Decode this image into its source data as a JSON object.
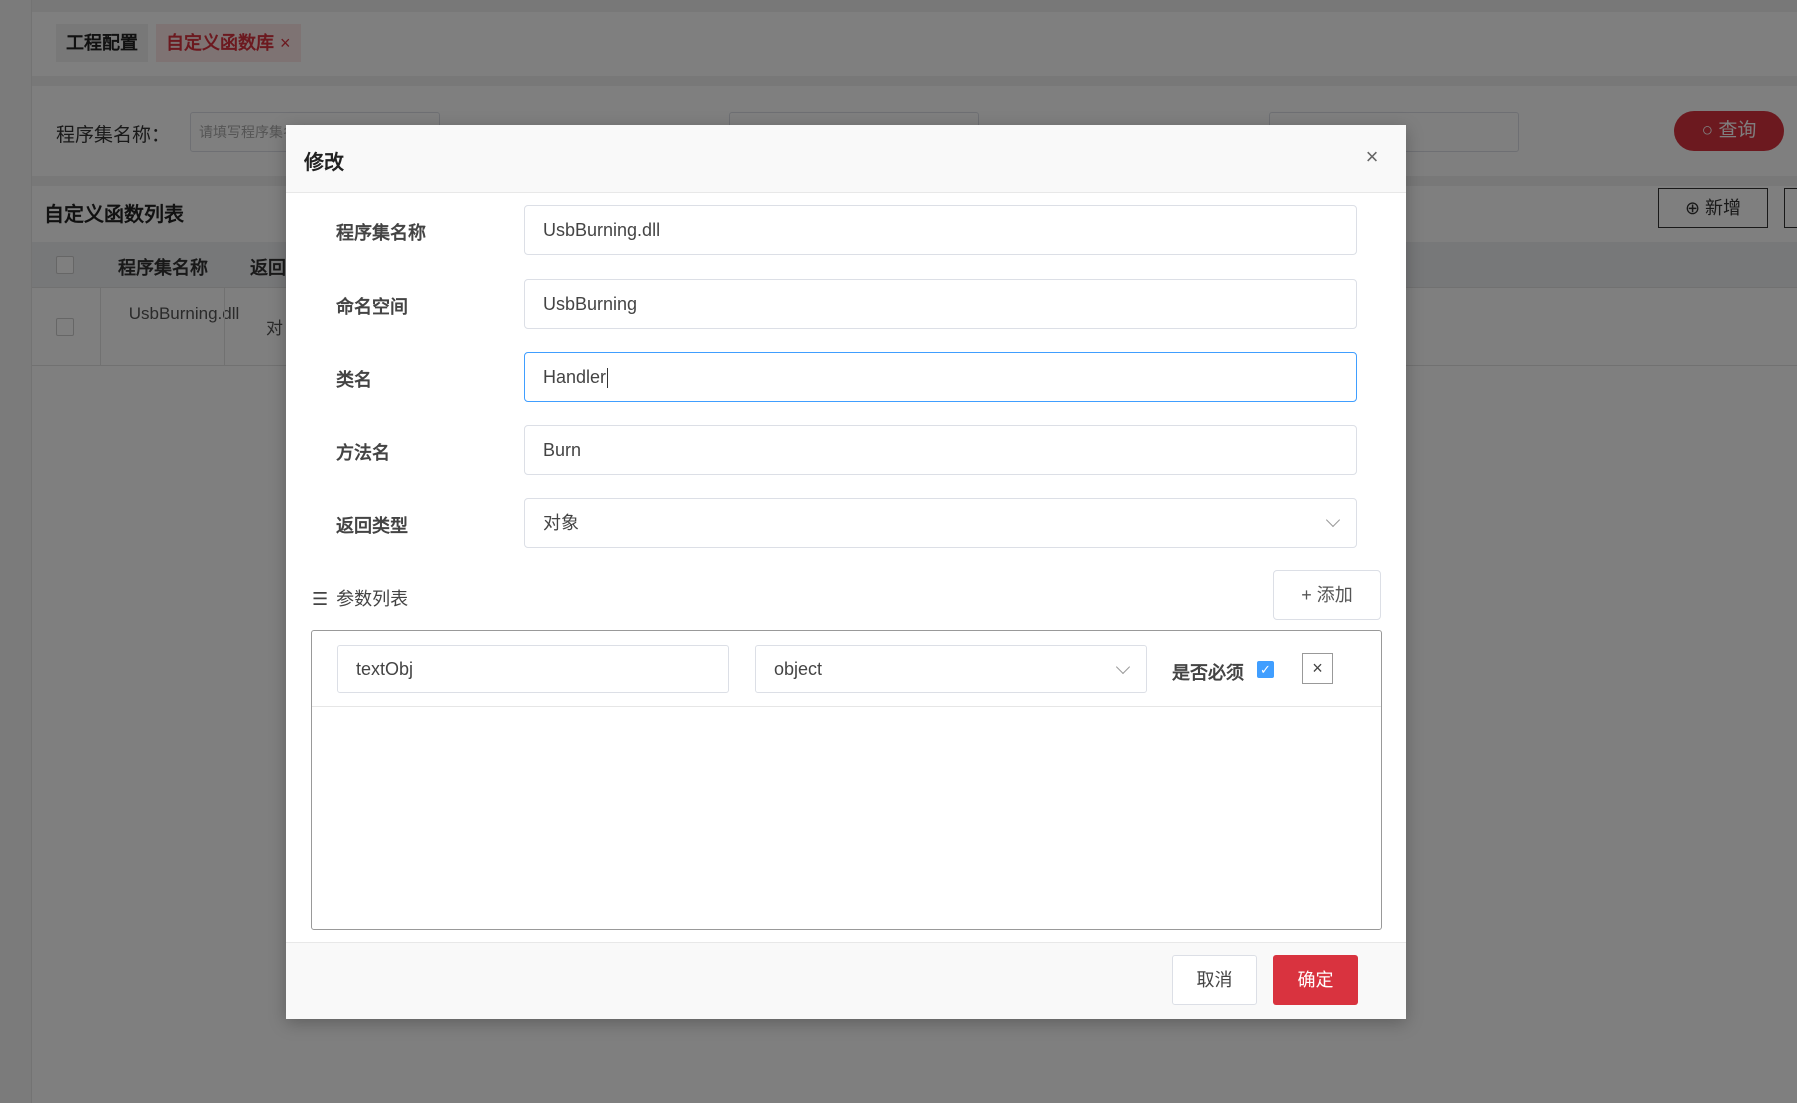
{
  "tabs": [
    {
      "label": "工程配置"
    },
    {
      "label": "自定义函数库",
      "close": "×"
    }
  ],
  "search": {
    "assembly_label": "程序集名称：",
    "assembly_placeholder": "请填写程序集名称",
    "query_label": "查询"
  },
  "list": {
    "title": "自定义函数列表",
    "add_label": "新增",
    "headers": [
      "程序集名称",
      "返回"
    ],
    "rows": [
      {
        "assembly": "UsbBurning.dll",
        "return_type": "对"
      }
    ]
  },
  "modal": {
    "title": "修改",
    "close": "×",
    "fields": [
      {
        "label": "程序集名称",
        "value": "UsbBurning.dll"
      },
      {
        "label": "命名空间",
        "value": "UsbBurning"
      },
      {
        "label": "类名",
        "value": "Handler"
      },
      {
        "label": "方法名",
        "value": "Burn"
      },
      {
        "label": "返回类型",
        "value": "对象"
      }
    ],
    "params_title": "参数列表",
    "add_param_label": "添加",
    "params": [
      {
        "name": "textObj",
        "type": "object",
        "required_label": "是否必须",
        "required": true
      }
    ],
    "cancel_label": "取消",
    "ok_label": "确定"
  },
  "colors": {
    "accent": "#d9333f",
    "focus": "#409eff"
  }
}
